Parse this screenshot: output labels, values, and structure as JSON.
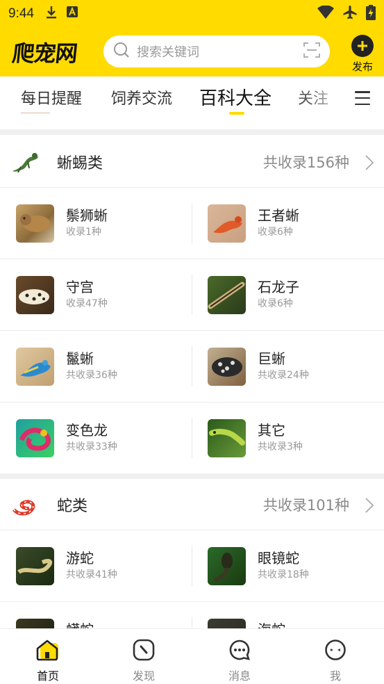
{
  "status_bar": {
    "time": "9:44",
    "left_icons": [
      "download-icon",
      "a-box-icon"
    ],
    "right_icons": [
      "wifi-icon",
      "airplane-icon",
      "battery-charging-icon"
    ]
  },
  "header": {
    "logo": "爬宠网",
    "search_placeholder": "搜索关键词",
    "publish_label": "发布",
    "accent_color": "#FFDB00"
  },
  "tabs": {
    "items": [
      "每日提醒",
      "饲养交流",
      "百科大全",
      "关注"
    ],
    "active": "百科大全",
    "menu_icon": "menu-icon"
  },
  "sections": [
    {
      "name": "蜥蜴类",
      "count": "共收录156种",
      "rows": [
        [
          {
            "name": "鬃狮蜥",
            "count": "收录1种"
          },
          {
            "name": "王者蜥",
            "count": "收录6种"
          }
        ],
        [
          {
            "name": "守宫",
            "count": "收录47种"
          },
          {
            "name": "石龙子",
            "count": "收录6种"
          }
        ],
        [
          {
            "name": "鬣蜥",
            "count": "共收录36种"
          },
          {
            "name": "巨蜥",
            "count": "共收录24种"
          }
        ],
        [
          {
            "name": "变色龙",
            "count": "共收录33种"
          },
          {
            "name": "其它",
            "count": "共收录3种"
          }
        ]
      ]
    },
    {
      "name": "蛇类",
      "count": "共收录101种",
      "rows": [
        [
          {
            "name": "游蛇",
            "count": "共收录41种"
          },
          {
            "name": "眼镜蛇",
            "count": "共收录18种"
          }
        ],
        [
          {
            "name": "蟒蛇",
            "count": ""
          },
          {
            "name": "海蛇",
            "count": ""
          }
        ]
      ]
    }
  ],
  "bottom_nav": {
    "items": [
      "首页",
      "发现",
      "消息",
      "我"
    ],
    "active": "首页"
  }
}
